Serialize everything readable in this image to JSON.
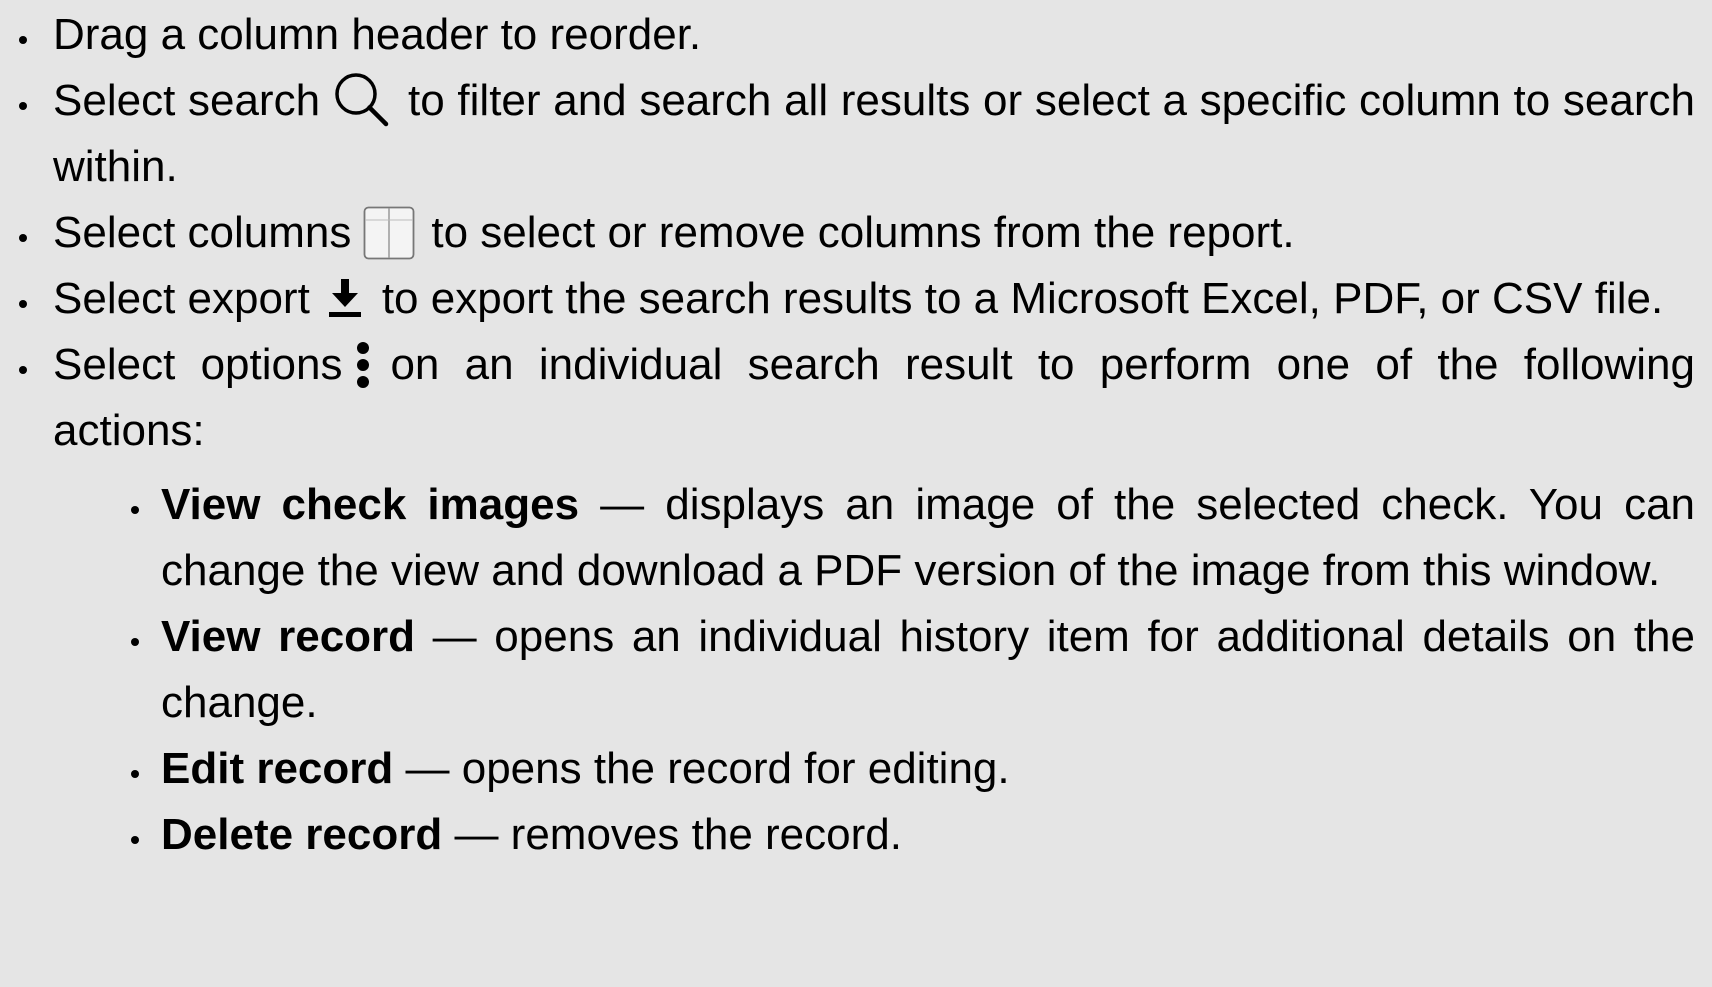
{
  "bullets": [
    {
      "text_before": "Drag a column header to reorder.",
      "icon": null,
      "text_after": ""
    },
    {
      "text_before": "Select search",
      "icon": "search-icon",
      "text_after": "to filter and search all results or select a specific column to search within."
    },
    {
      "text_before": "Select columns",
      "icon": "columns-icon",
      "text_after": "to select or remove columns from the report."
    },
    {
      "text_before": "Select export",
      "icon": "export-icon",
      "text_after": "to export the search results to a Microsoft Excel, PDF, or CSV file."
    },
    {
      "text_before": "Select options",
      "icon": "options-icon",
      "text_after": "on an individual search result to perform one of the following actions:"
    }
  ],
  "actions": [
    {
      "term": "View check images",
      "description": " — displays an image of the selected check. You can change the view and download a PDF version of the image from this window."
    },
    {
      "term": "View record",
      "description": " — opens an individual history item for additional details on the change."
    },
    {
      "term": "Edit record",
      "description": " — opens the record for editing."
    },
    {
      "term": "Delete record",
      "description": " — removes the record."
    }
  ]
}
